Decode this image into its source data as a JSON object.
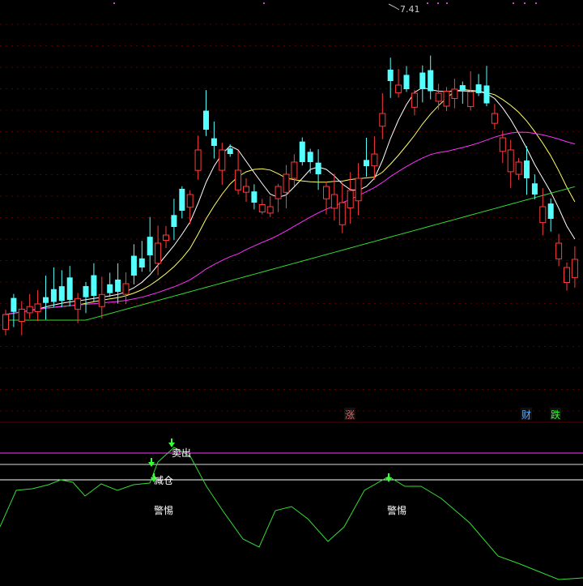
{
  "chart_data": [
    {
      "type": "candlestick",
      "title": "",
      "price_label": "7.41",
      "grid": true,
      "colors": {
        "up": "#ff3b3b",
        "down": "#54ffff",
        "ma5": "#ffffff",
        "ma10": "#ffff66",
        "ma30": "#ff33ff",
        "ma60": "#33dd33"
      },
      "bar_count": 72,
      "candles_note": "approximate values read from chart",
      "event_markers": [
        {
          "label": "涨",
          "color": "#ff5555"
        },
        {
          "label": "财",
          "color": "#55aaff"
        },
        {
          "label": "跌",
          "color": "#33ff33"
        }
      ]
    },
    {
      "type": "line",
      "title": "",
      "series": [
        {
          "color": "#33dd33"
        }
      ],
      "reference_lines": [
        {
          "label": "卖出",
          "color": "#ff33ff"
        },
        {
          "label": "减仓",
          "color": "#ffffff"
        }
      ],
      "annotations": [
        {
          "label": "卖出"
        },
        {
          "label": "减仓"
        },
        {
          "label": "警惕"
        },
        {
          "label": "警惕"
        }
      ]
    }
  ]
}
